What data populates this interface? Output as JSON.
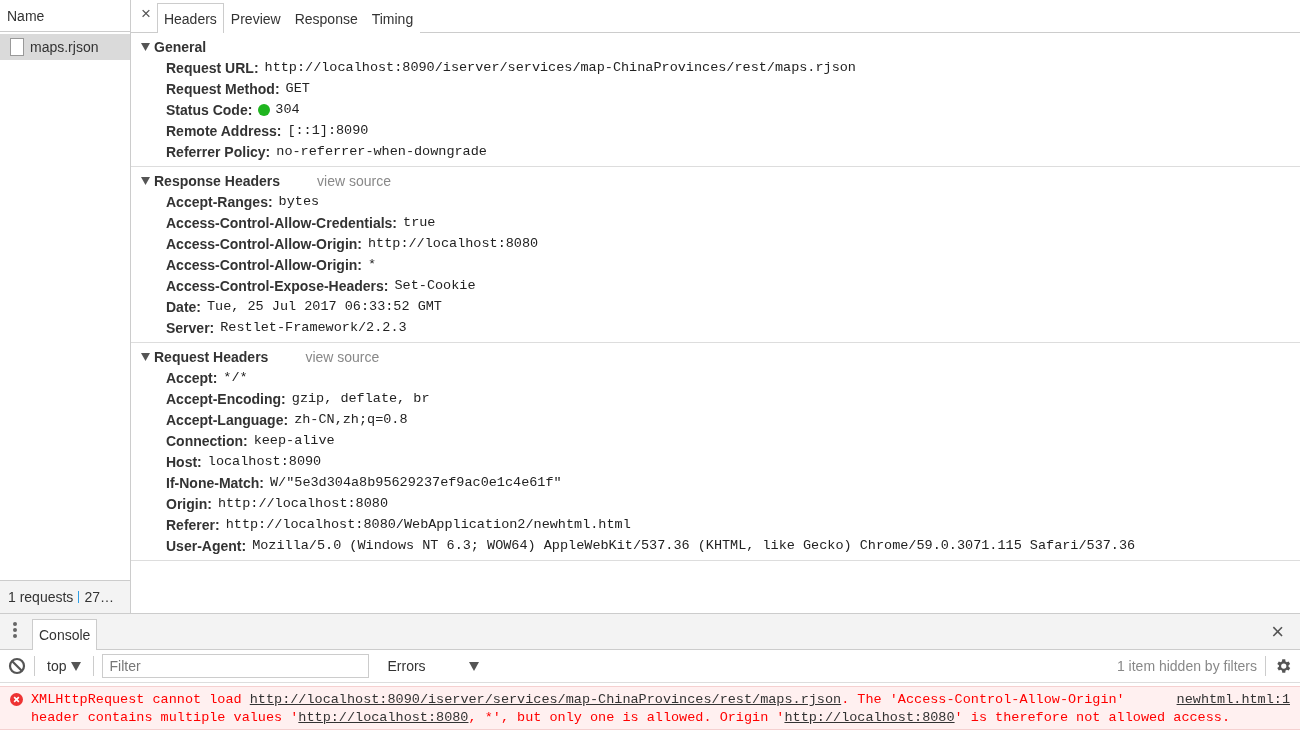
{
  "requests": {
    "column": "Name",
    "items": [
      {
        "name": "maps.rjson",
        "selected": true
      }
    ],
    "summary": "1 requests",
    "summary_2": "27…"
  },
  "details": {
    "close": "×",
    "tabs": [
      {
        "label": "Headers",
        "selected": true
      },
      {
        "label": "Preview",
        "selected": false
      },
      {
        "label": "Response",
        "selected": false
      },
      {
        "label": "Timing",
        "selected": false
      }
    ],
    "sections": [
      {
        "title": "General",
        "expanded": true,
        "rows": [
          {
            "name": "Request URL:",
            "value": "http://localhost:8090/iserver/services/map-ChinaProvinces/rest/maps.rjson"
          },
          {
            "name": "Request Method:",
            "value": "GET"
          },
          {
            "name": "Status Code:",
            "value": "304",
            "color": "#1fb51f"
          },
          {
            "name": "Remote Address:",
            "value": "[::1]:8090"
          },
          {
            "name": "Referrer Policy:",
            "value": "no-referrer-when-downgrade"
          }
        ]
      },
      {
        "title": "Response Headers",
        "expanded": true,
        "view_source": "view source",
        "rows": [
          {
            "name": "Accept-Ranges:",
            "value": "bytes"
          },
          {
            "name": "Access-Control-Allow-Credentials:",
            "value": "true"
          },
          {
            "name": "Access-Control-Allow-Origin:",
            "value": "http://localhost:8080"
          },
          {
            "name": "Access-Control-Allow-Origin:",
            "value": "*"
          },
          {
            "name": "Access-Control-Expose-Headers:",
            "value": "Set-Cookie"
          },
          {
            "name": "Date:",
            "value": "Tue, 25 Jul 2017 06:33:52 GMT"
          },
          {
            "name": "Server:",
            "value": "Restlet-Framework/2.2.3"
          }
        ]
      },
      {
        "title": "Request Headers",
        "expanded": true,
        "view_source": "view source",
        "rows": [
          {
            "name": "Accept:",
            "value": "*/*"
          },
          {
            "name": "Accept-Encoding:",
            "value": "gzip, deflate, br"
          },
          {
            "name": "Accept-Language:",
            "value": "zh-CN,zh;q=0.8"
          },
          {
            "name": "Connection:",
            "value": "keep-alive"
          },
          {
            "name": "Host:",
            "value": "localhost:8090"
          },
          {
            "name": "If-None-Match:",
            "value": "W/\"5e3d304a8b95629237ef9ac0e1c4e61f\""
          },
          {
            "name": "Origin:",
            "value": "http://localhost:8080"
          },
          {
            "name": "Referer:",
            "value": "http://localhost:8080/WebApplication2/newhtml.html"
          },
          {
            "name": "User-Agent:",
            "value": "Mozilla/5.0 (Windows NT 6.3; WOW64) AppleWebKit/537.36 (KHTML, like Gecko) Chrome/59.0.3071.115 Safari/537.36"
          }
        ]
      }
    ]
  },
  "drawer": {
    "tabs": [
      {
        "label": "Console",
        "selected": true
      }
    ],
    "close": "×",
    "context": "top",
    "filter_placeholder": "Filter",
    "level": "Errors",
    "hidden_note": "1 item hidden by filters",
    "messages": [
      {
        "kind": "error",
        "source": "newhtml.html:1",
        "lines": [
          [
            {
              "kind": "text",
              "text": "XMLHttpRequest cannot load "
            },
            {
              "kind": "link",
              "text": "http://localhost:8090/iserver/services/map-ChinaProvinces/rest/maps.rjson"
            },
            {
              "kind": "text",
              "text": ". The 'Access-Control-Allow-Origin'"
            }
          ],
          [
            {
              "kind": "text",
              "text": "header contains multiple values '"
            },
            {
              "kind": "link",
              "text": "http://localhost:8080"
            },
            {
              "kind": "text",
              "text": ", *', but only one is allowed. Origin '"
            },
            {
              "kind": "link",
              "text": "http://localhost:8080"
            },
            {
              "kind": "text",
              "text": "' is therefore not allowed access."
            }
          ]
        ]
      }
    ]
  }
}
